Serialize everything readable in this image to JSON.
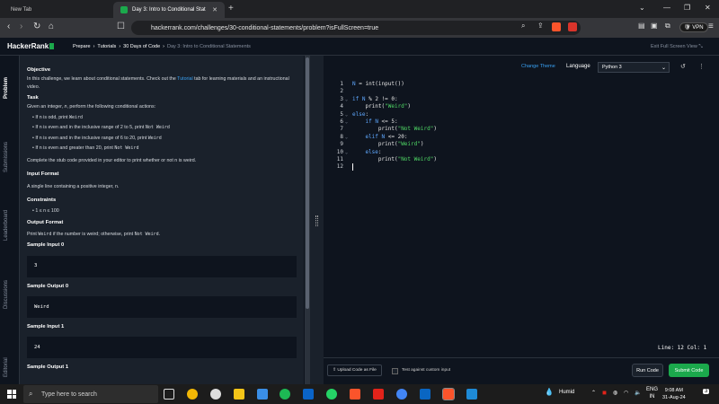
{
  "browser": {
    "tabs": [
      {
        "label": "New Tab"
      },
      {
        "label": "Day 3: Intro to Conditional Stat"
      }
    ],
    "url": "hackerrank.com/challenges/30-conditional-statements/problem?isFullScreen=true",
    "vpn_label": "VPN"
  },
  "header": {
    "logo": "HackerRank",
    "breadcrumbs": [
      "Prepare",
      "Tutorials",
      "30 Days of Code",
      "Day 3: Intro to Conditional Statements"
    ],
    "exit_full_screen": "Exit Full Screen View"
  },
  "side_tabs": [
    "Problem",
    "Submissions",
    "Leaderboard",
    "Discussions",
    "Editorial"
  ],
  "problem": {
    "objective_heading": "Objective",
    "objective_text_1": "In this challenge, we learn about conditional statements. Check out the ",
    "tutorial_link": "Tutorial",
    "objective_text_2": " tab for learning materials and an instructional video.",
    "task_heading": "Task",
    "task_intro_1": "Given an integer, ",
    "task_intro_var": "n",
    "task_intro_2": ", perform the following conditional actions:",
    "bullets": [
      {
        "pre": "If n is odd, print ",
        "code": "Weird"
      },
      {
        "pre": "If n is even and in the inclusive range of 2 to 5, print ",
        "code": "Not Weird"
      },
      {
        "pre": "If n is even and in the inclusive range of 6 to 20, print ",
        "code": "Weird"
      },
      {
        "pre": "If n is even and greater than 20, print ",
        "code": "Not Weird"
      }
    ],
    "complete_text": "Complete the stub code provided in your editor to print whether or not n is weird.",
    "input_format_heading": "Input Format",
    "input_format_text": "A single line containing a positive integer, n.",
    "constraints_heading": "Constraints",
    "constraint": "1 ≤ n ≤ 100",
    "output_format_heading": "Output Format",
    "output_pre": "Print ",
    "output_code_1": "Weird",
    "output_mid": " if the number is weird; otherwise, print ",
    "output_code_2": "Not Weird",
    "output_end": ".",
    "sample_input_0_heading": "Sample Input 0",
    "sample_input_0": "3",
    "sample_output_0_heading": "Sample Output 0",
    "sample_output_0": "Weird",
    "sample_input_1_heading": "Sample Input 1",
    "sample_input_1": "24",
    "sample_output_1_heading": "Sample Output 1"
  },
  "editor": {
    "change_theme": "Change Theme",
    "language_label": "Language",
    "language_value": "Python 3",
    "position": "Line: 12 Col: 1",
    "upload_label": "Upload Code as File",
    "custom_input_label": "Test against custom input",
    "run_label": "Run Code",
    "submit_label": "Submit Code",
    "code_lines": [
      "N = int(input())",
      "",
      "if N % 2 != 0:",
      "    print(\"Weird\")",
      "else:",
      "    if N <= 5:",
      "        print(\"Not Weird\")",
      "    elif N <= 20:",
      "        print(\"Weird\")",
      "    else:",
      "        print(\"Not Weird\")",
      ""
    ]
  },
  "taskbar": {
    "search_placeholder": "Type here to search",
    "weather": "Humid",
    "lang": "ENG",
    "region": "IN",
    "time": "9:08 AM",
    "date": "31-Aug-24",
    "notifications": "3"
  }
}
